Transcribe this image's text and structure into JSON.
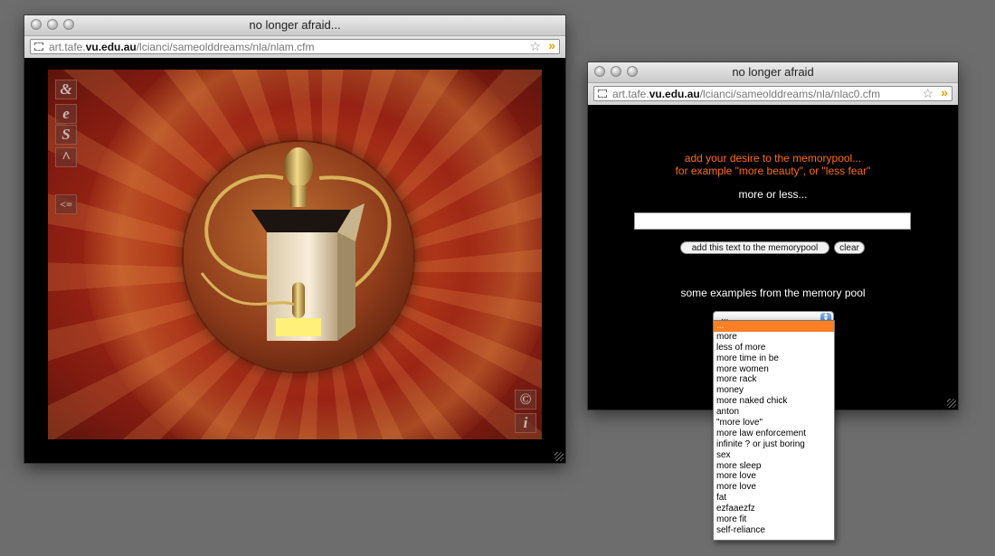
{
  "left_window": {
    "title": "no longer afraid...",
    "url_pre": "art.tafe.",
    "url_bold": "vu.edu.au",
    "url_post": "/lcianci/sameolddreams/nla/nlam.cfm",
    "toolbar": [
      "&",
      "e",
      "S",
      "^",
      "<="
    ],
    "corner_tools": [
      "©",
      "i"
    ]
  },
  "right_window": {
    "title": "no longer afraid",
    "url_pre": "art.tafe.",
    "url_bold": "vu.edu.au",
    "url_post": "/lcianci/sameolddreams/nla/nlac0.cfm",
    "prompt_line1": "add your desire to the memorypool...",
    "prompt_line2": "for example \"more beauty\", or \"less fear\"",
    "more_or_less": "more or less...",
    "input_value": "",
    "add_button": "add this text to the memorypool",
    "clear_button": "clear",
    "examples_heading": "some examples from the memory pool",
    "select_value": "..."
  },
  "dropdown_options": [
    "...",
    "more",
    "less of more",
    "more time in be",
    "more women",
    "more rack",
    "money",
    "more naked chick",
    "anton",
    "\"more love\"",
    "more law enforcement",
    "infinite ? or just boring",
    "sex",
    "more sleep",
    "more love",
    "more love",
    "fat",
    "ezfaaezfz",
    "more fit",
    "self-reliance"
  ],
  "colors": {
    "accent": "#ff6d00",
    "selected_option": "#ff7f24",
    "desktop": "#6d6d6d"
  }
}
